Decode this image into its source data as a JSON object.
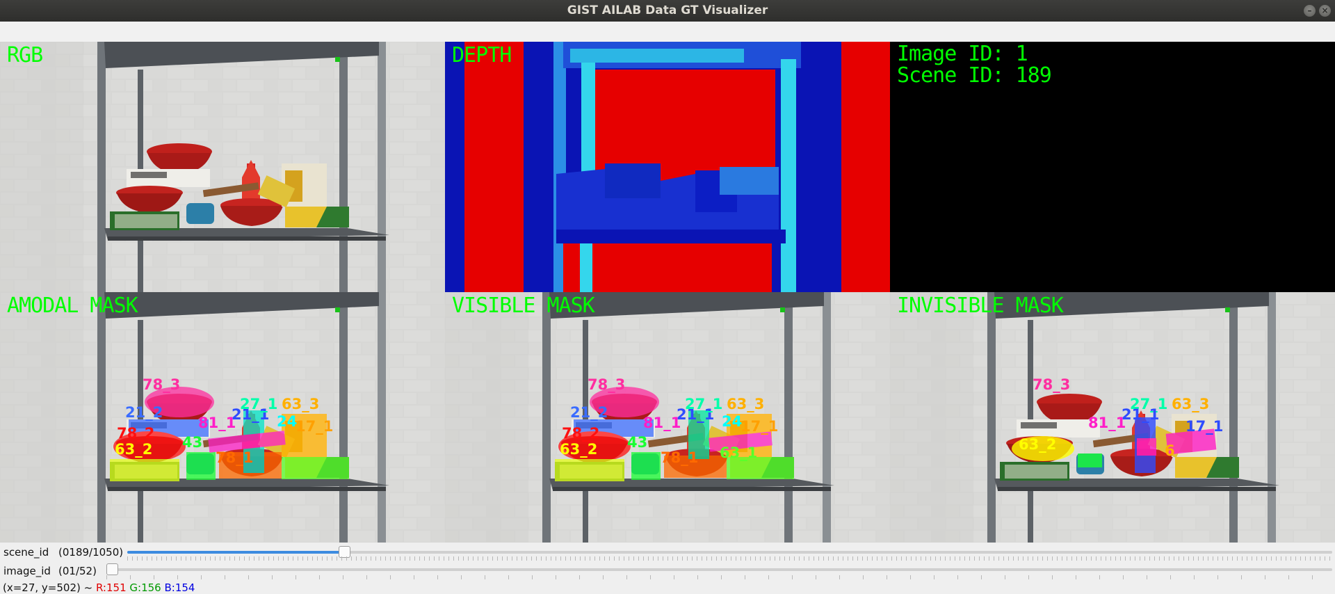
{
  "window": {
    "title": "GIST AILAB Data GT Visualizer"
  },
  "panels": {
    "rgb": "RGB",
    "depth": "DEPTH",
    "info": {
      "image_id": "Image ID: 1",
      "scene_id": "Scene ID: 189"
    },
    "amodal": "AMODAL MASK",
    "visible": "VISIBLE MASK",
    "invisible": "INVISIBLE MASK"
  },
  "object_labels": {
    "amodal": [
      "78_3",
      "21_2",
      "78_2",
      "63_2",
      "81_1",
      "21_1",
      "27_1",
      "63_3",
      "24",
      "17_1",
      "43",
      "78_1"
    ],
    "visible": [
      "78_3",
      "21_2",
      "78_2",
      "63_2",
      "81_1",
      "21_1",
      "27_1",
      "63_3",
      "24",
      "17_1",
      "43",
      "78_1",
      "63_1"
    ],
    "invisible": [
      "78_3",
      "27_1",
      "63_3",
      "21_1",
      "17_1",
      "81_1",
      "63_2",
      "6"
    ]
  },
  "sliders": {
    "scene": {
      "name": "scene_id",
      "count": "(0189/1050)",
      "value": 189,
      "max": 1050
    },
    "image": {
      "name": "image_id",
      "count": "(01/52)",
      "value": 1,
      "max": 52
    }
  },
  "status": {
    "coords": "(x=27, y=502) ~",
    "r": "R:151",
    "g": "G:156",
    "b": "B:154"
  },
  "colors": {
    "label_green": "#00ff00",
    "slider_fill": "#3d8be0",
    "depth_far": "#e60000",
    "depth_near": "#0a14b4"
  }
}
